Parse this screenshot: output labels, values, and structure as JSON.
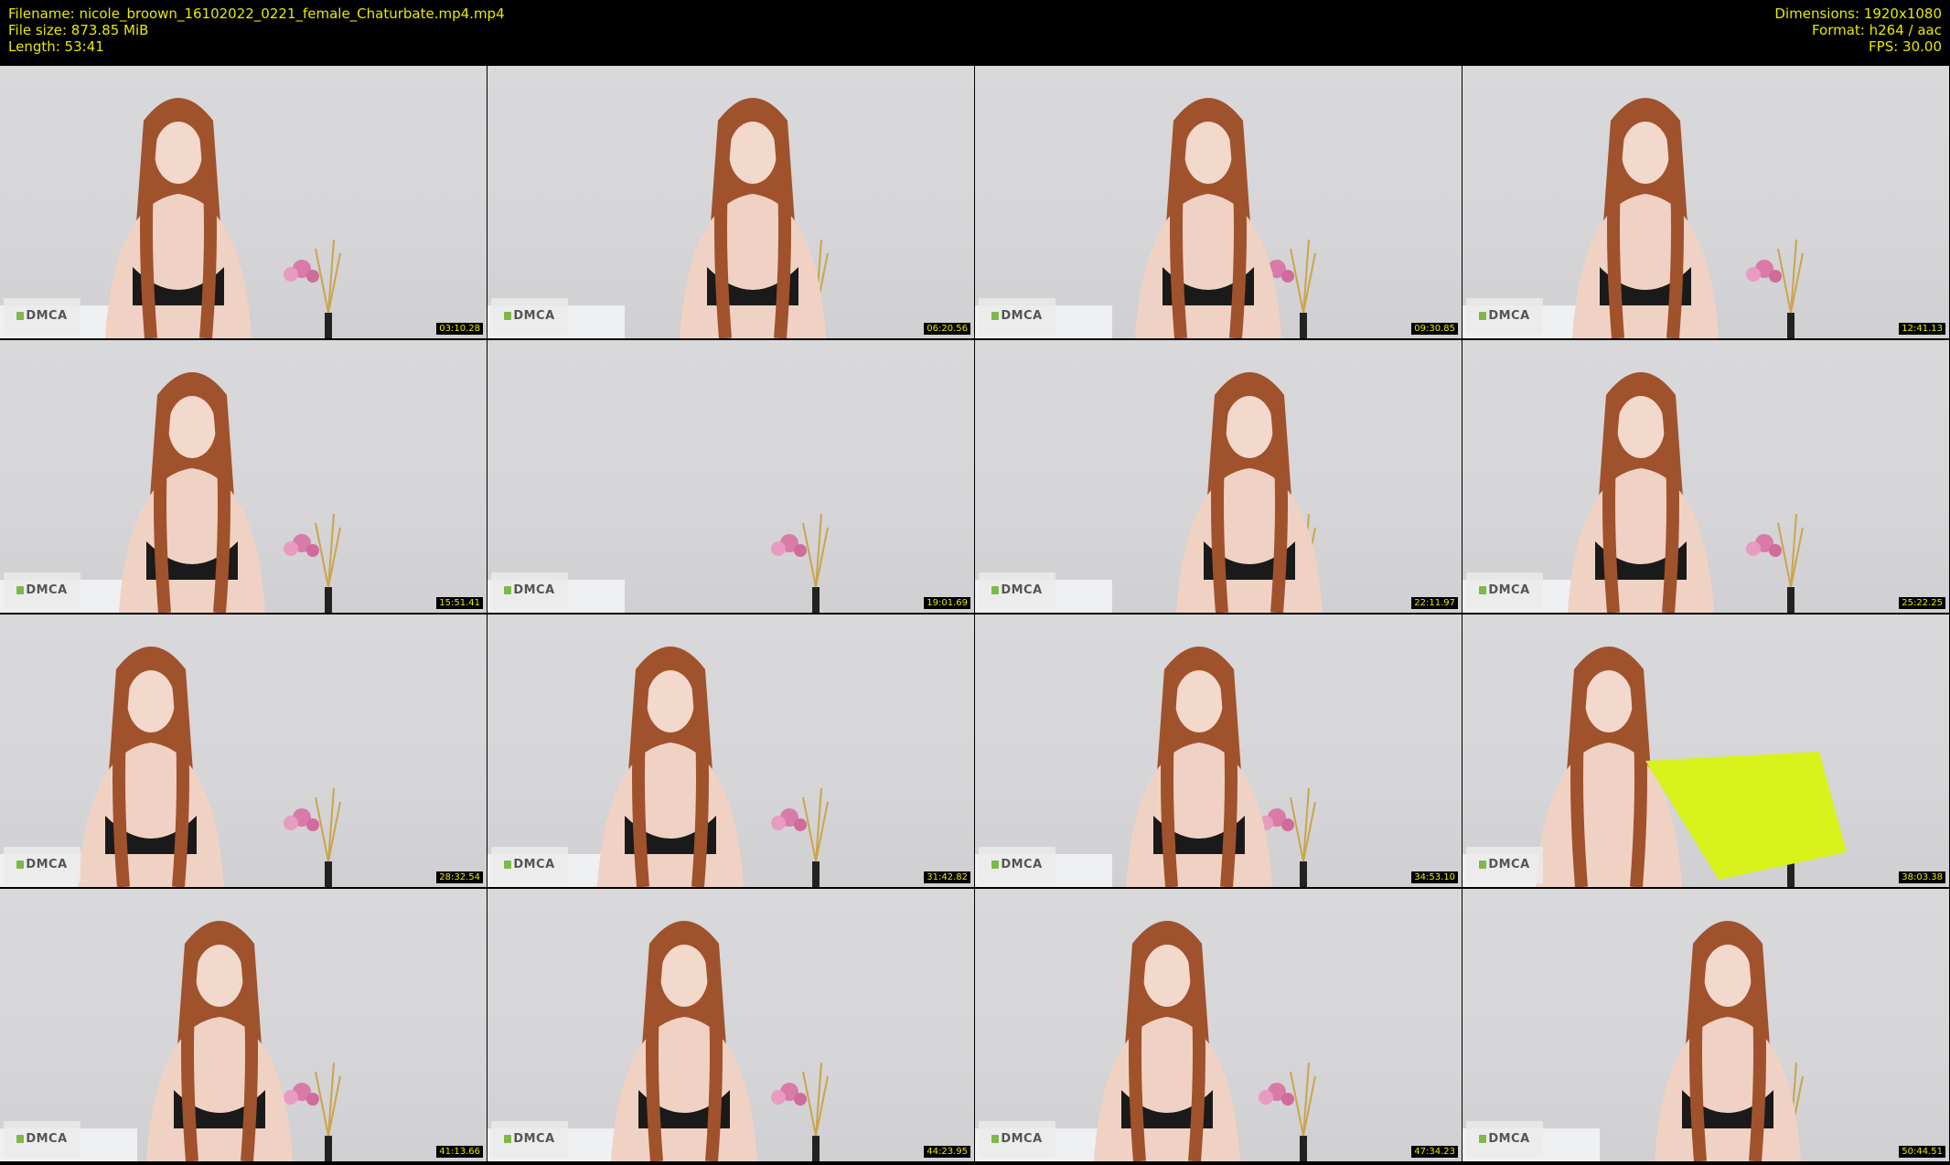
{
  "header": {
    "filename": "Filename: nicole_broown_16102022_0221_female_Chaturbate.mp4.mp4",
    "filesize": "File size: 873.85 MiB",
    "length": "Length: 53:41",
    "dimensions": "Dimensions: 1920x1080",
    "format": "Format: h264 / aac",
    "fps": "FPS: 30.00"
  },
  "colors": {
    "background": "#000000",
    "text": "#e8e800",
    "wall": "#d7d6d9",
    "hair": "#a0522d",
    "top": "#1a1a1a",
    "skirt": "#d8f21c"
  },
  "watermark": "DMCA",
  "thumbnails": [
    {
      "timestamp": "03:10.28"
    },
    {
      "timestamp": "06:20.56"
    },
    {
      "timestamp": "09:30.85"
    },
    {
      "timestamp": "12:41.13"
    },
    {
      "timestamp": "15:51.41"
    },
    {
      "timestamp": "19:01.69"
    },
    {
      "timestamp": "22:11.97"
    },
    {
      "timestamp": "25:22.25"
    },
    {
      "timestamp": "28:32.54"
    },
    {
      "timestamp": "31:42.82"
    },
    {
      "timestamp": "34:53.10"
    },
    {
      "timestamp": "38:03.38"
    },
    {
      "timestamp": "41:13.66"
    },
    {
      "timestamp": "44:23.95"
    },
    {
      "timestamp": "47:34.23"
    },
    {
      "timestamp": "50:44.51"
    }
  ]
}
